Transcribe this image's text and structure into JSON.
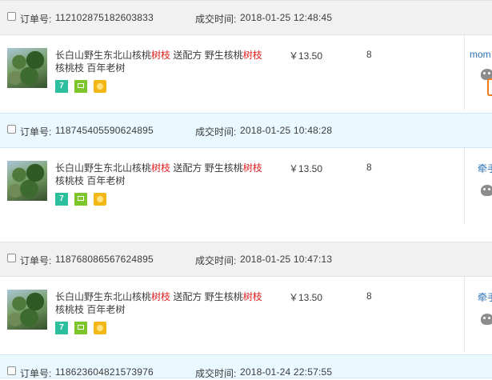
{
  "labels": {
    "order_no": "订单号:",
    "deal_time": "成交时间:"
  },
  "orders": [
    {
      "order_no": "112102875182603833",
      "deal_time": "2018-01-25 12:48:45",
      "title_a": "长白山野生东北山核桃",
      "title_hl1": "树枝",
      "title_b": " 送配方 野生核桃",
      "title_hl2": "树枝",
      "title_c": "核桃枝 百年老树",
      "price": "￥13.50",
      "qty": "8",
      "seller": "mom"
    },
    {
      "order_no": "118745405590624895",
      "deal_time": "2018-01-25 10:48:28",
      "title_a": "长白山野生东北山核桃",
      "title_hl1": "树枝",
      "title_b": " 送配方 野生核桃",
      "title_hl2": "树枝",
      "title_c": "核桃枝 百年老树",
      "price": "￥13.50",
      "qty": "8",
      "seller": "牵手"
    },
    {
      "order_no": "118768086567624895",
      "deal_time": "2018-01-25 10:47:13",
      "title_a": "长白山野生东北山核桃",
      "title_hl1": "树枝",
      "title_b": " 送配方 野生核桃",
      "title_hl2": "树枝",
      "title_c": "核桃枝 百年老树",
      "price": "￥13.50",
      "qty": "8",
      "seller": "牵手"
    },
    {
      "order_no": "118623604821573976",
      "deal_time": "2018-01-24 22:57:55"
    }
  ],
  "badges": {
    "b1": "7",
    "b1_icon": "seven-day-return-icon",
    "b2_icon": "screen-consumer-protection-icon",
    "b3_icon": "gold-medal-icon"
  },
  "colors": {
    "highlight": "#e02020",
    "seller_link": "#2b72b4",
    "head_grey": "#f1f1f1",
    "head_blue": "#eaf8ff"
  }
}
